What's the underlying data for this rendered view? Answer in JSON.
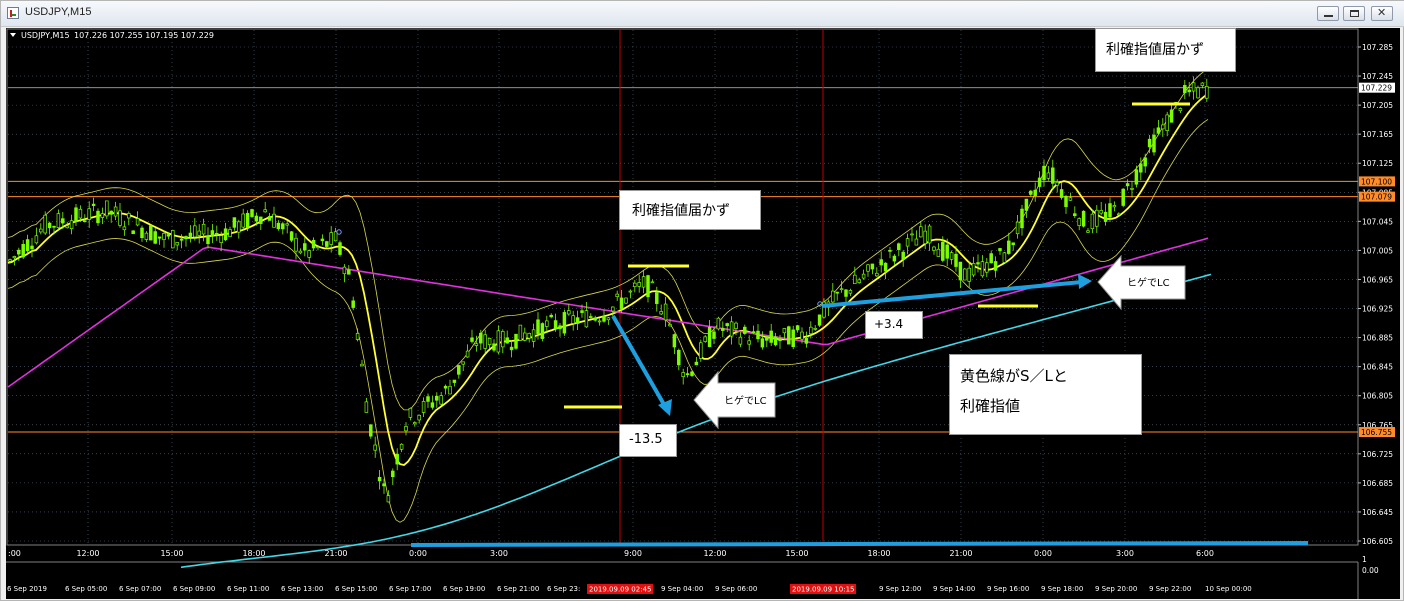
{
  "window": {
    "title": "USDJPY,M15"
  },
  "chart_info": {
    "symbol_timeframe": "USDJPY,M15",
    "ohlc": "107.226 107.255 107.195 107.229"
  },
  "colors": {
    "background": "#000000",
    "grid": "#5a6a7a",
    "candle": "#7CFC00",
    "price_axis_text": "#ffffff",
    "bollinger": "#d8d84a",
    "ma_yellow": "#ffff33",
    "ma_magenta": "#e030e0",
    "ma_cyan": "#40d8e8",
    "blue_arrow": "#1ea0e0",
    "level_orange": "#ff8c28",
    "red_vline": "#c00000",
    "current_price": "#9aa6b4"
  },
  "price_axis": {
    "ticks": [
      "107.285",
      "107.245",
      "107.205",
      "107.165",
      "107.125",
      "107.085",
      "107.045",
      "107.005",
      "106.965",
      "106.925",
      "106.885",
      "106.845",
      "106.805",
      "106.765",
      "106.725",
      "106.685",
      "106.645",
      "106.605"
    ],
    "current_price": "107.229",
    "orange_levels": [
      "107.100",
      "107.079",
      "106.755"
    ]
  },
  "time_axis": {
    "top_labels": [
      ":00",
      "12:00",
      "15:00",
      "18:00",
      "21:00",
      "0:00",
      "3:00",
      "9:00",
      "12:00",
      "15:00",
      "18:00",
      "21:00",
      "0:00",
      "3:00",
      "6:00"
    ],
    "bottom_labels": [
      "6 Sep 2019",
      "6 Sep 05:00",
      "6 Sep 07:00",
      "6 Sep 09:00",
      "6 Sep 11:00",
      "6 Sep 13:00",
      "6 Sep 15:00",
      "6 Sep 17:00",
      "6 Sep 19:00",
      "6 Sep 21:00",
      "6 Sep 23:",
      "9 Sep 04:00",
      "9 Sep 06:00",
      "9 Sep 12:00",
      "9 Sep 14:00",
      "9 Sep 16:00",
      "9 Sep 18:00",
      "9 Sep 20:00",
      "9 Sep 22:00",
      "10 Sep 00:00"
    ],
    "highlight_1": "2019.09.09 02:45",
    "highlight_2": "2019.09.09 10:15"
  },
  "sub_axis": {
    "top": "1",
    "bottom": "0.00"
  },
  "annotations": {
    "top_right": "利確指値届かず",
    "middle": "利確指値届かず",
    "wick_lc_1": "ヒゲでLC",
    "wick_lc_2": "ヒゲでLC",
    "loss": "-13.5",
    "gain": "+3.4",
    "note_line1": "黄色線がS／Lと",
    "note_line2": "利確指値"
  }
}
